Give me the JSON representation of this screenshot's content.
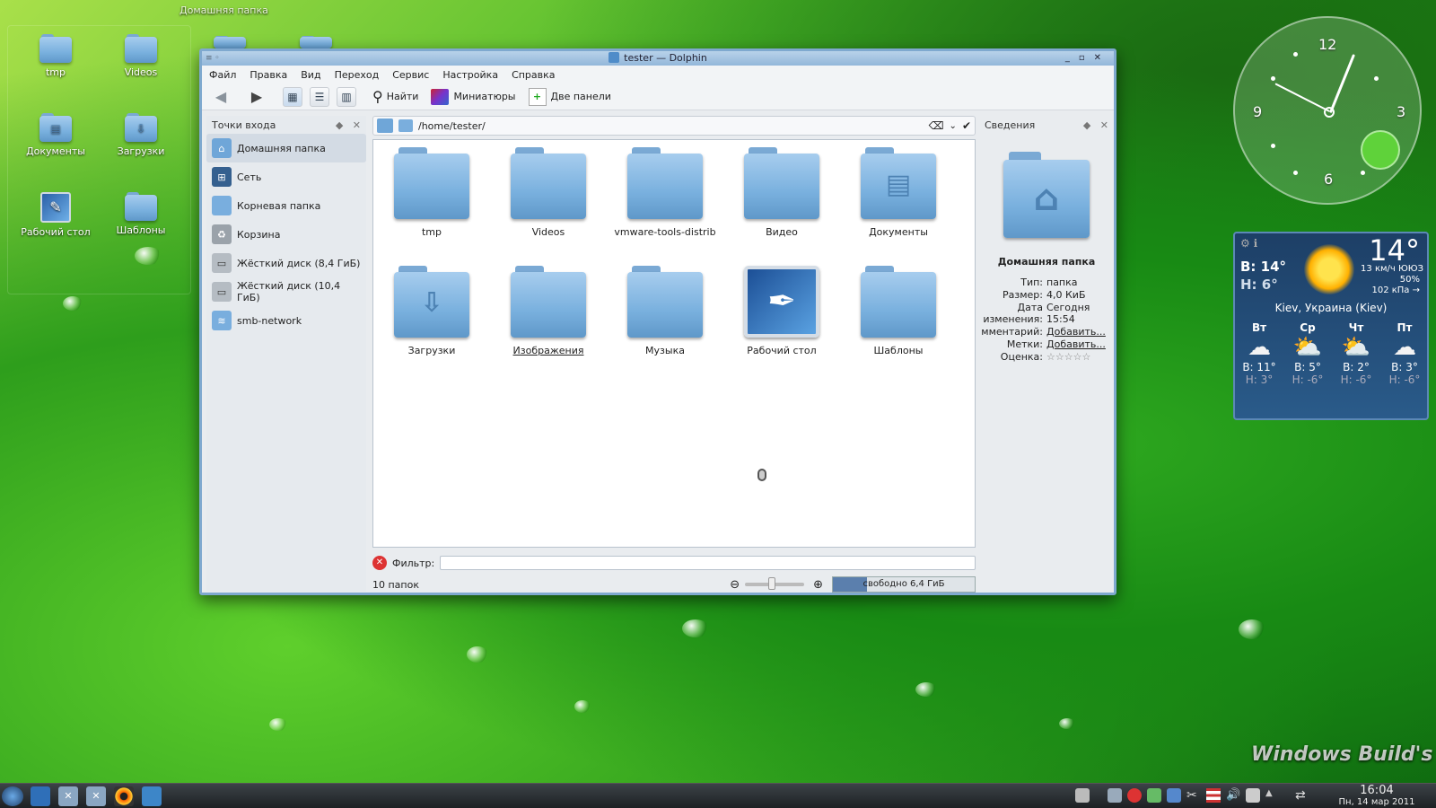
{
  "desktop": {
    "panel_title": "Домашняя папка",
    "icons": [
      {
        "label": "tmp"
      },
      {
        "label": "Videos"
      },
      {
        "label": "Документы"
      },
      {
        "label": "Загрузки"
      },
      {
        "label": "Рабочий стол"
      },
      {
        "label": "Шаблоны"
      }
    ]
  },
  "window": {
    "title": "tester — Dolphin",
    "menu": [
      "Файл",
      "Правка",
      "Вид",
      "Переход",
      "Сервис",
      "Настройка",
      "Справка"
    ],
    "toolbar": {
      "find": "Найти",
      "thumbnails": "Миниатюры",
      "split": "Две панели"
    },
    "places": {
      "title": "Точки входа",
      "items": [
        {
          "label": "Домашняя папка"
        },
        {
          "label": "Сеть"
        },
        {
          "label": "Корневая папка"
        },
        {
          "label": "Корзина"
        },
        {
          "label": "Жёсткий диск (8,4 ГиБ)"
        },
        {
          "label": "Жёсткий диск (10,4 ГиБ)"
        },
        {
          "label": "smb-network"
        }
      ]
    },
    "path": "/home/tester/",
    "files": [
      {
        "name": "tmp"
      },
      {
        "name": "Videos"
      },
      {
        "name": "vmware-tools-distrib"
      },
      {
        "name": "Видео"
      },
      {
        "name": "Документы"
      },
      {
        "name": "Загрузки"
      },
      {
        "name": "Изображения"
      },
      {
        "name": "Музыка"
      },
      {
        "name": "Рабочий стол"
      },
      {
        "name": "Шаблоны"
      }
    ],
    "filter_label": "Фильтр:",
    "filter_value": "",
    "status_text": "10 папок",
    "free_space": "свободно 6,4 ГиБ",
    "info": {
      "title": "Сведения",
      "name": "Домашняя папка",
      "type_label": "Тип:",
      "type_value": "папка",
      "size_label": "Размер:",
      "size_value": "4,0 КиБ",
      "date_label": "Дата изменения:",
      "date_value_1": "Сегодня",
      "date_value_2": "15:54",
      "comment_label": "мментарий:",
      "comment_value": "Добавить...",
      "tags_label": "Метки:",
      "tags_value": "Добавить...",
      "rating_label": "Оценка:",
      "rating_value": "☆☆☆☆☆"
    }
  },
  "clock": {
    "n12": "12",
    "n3": "3",
    "n6": "6",
    "n9": "9"
  },
  "weather": {
    "temp": "14°",
    "high": "В: 14°",
    "low": "Н: 6°",
    "wind": "13 км/ч ЮЮЗ",
    "humidity": "50%",
    "pressure": "102 кПа →",
    "location": "Kiev, Украина (Kiev)",
    "days": [
      {
        "name": "Вт",
        "hi": "В: 11°",
        "lo": "Н: 3°"
      },
      {
        "name": "Ср",
        "hi": "В: 5°",
        "lo": "Н: -6°"
      },
      {
        "name": "Чт",
        "hi": "В: 2°",
        "lo": "Н: -6°"
      },
      {
        "name": "Пт",
        "hi": "В: 3°",
        "lo": "Н: -6°"
      }
    ]
  },
  "taskbar": {
    "time": "16:04",
    "date": "Пн, 14 мар 2011"
  },
  "watermark": "Windows Build's"
}
